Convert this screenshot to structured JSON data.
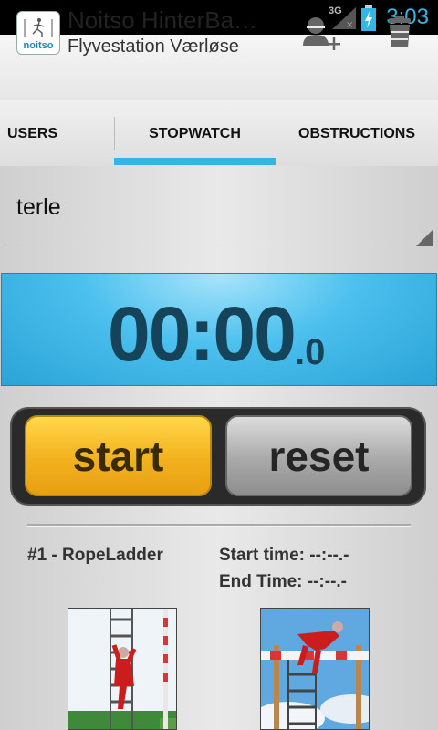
{
  "status_bar": {
    "network": "3G",
    "time": "3:03"
  },
  "action_bar": {
    "logo_text": "noitso",
    "title": "Noitso HinterBa…",
    "subtitle": "Flyvestation Værløse",
    "add_user_icon": "add-user-icon",
    "trash_icon": "trash-icon"
  },
  "tabs": [
    {
      "label": "USERS"
    },
    {
      "label": "STOPWATCH",
      "selected": true
    },
    {
      "label": "OBSTRUCTIONS"
    }
  ],
  "accent_color": "#33b5e5",
  "spinner": {
    "selected": "terle"
  },
  "timer": {
    "main": "00:00",
    "fraction": ".0"
  },
  "buttons": {
    "start": "start",
    "reset": "reset"
  },
  "obstruction": {
    "name": "#1 - RopeLadder",
    "start_time": "Start time: --:--.-",
    "end_time": "End Time: --:--.-"
  }
}
